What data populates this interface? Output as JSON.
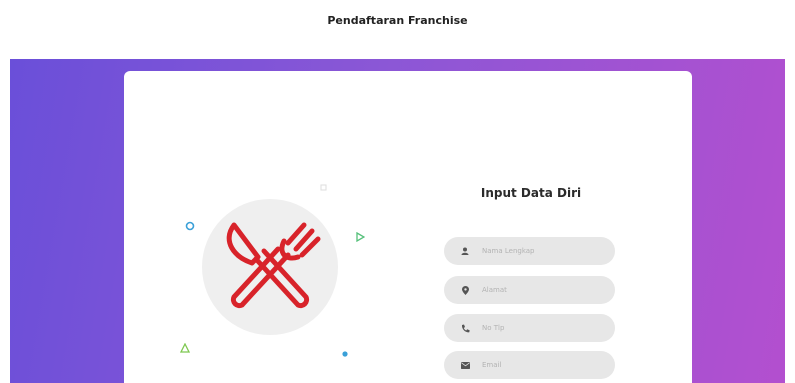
{
  "page": {
    "title": "Pendaftaran Franchise"
  },
  "form": {
    "title": "Input Data Diri",
    "fields": [
      {
        "icon": "user-icon",
        "placeholder": "Nama Lengkap"
      },
      {
        "icon": "map-marker-icon",
        "placeholder": "Alamat"
      },
      {
        "icon": "phone-icon",
        "placeholder": "No Tlp"
      },
      {
        "icon": "envelope-icon",
        "placeholder": "Email"
      }
    ]
  },
  "illustration": {
    "icon": "fork-knife-icon"
  },
  "colors": {
    "gradient_start": "#6a4fd9",
    "gradient_end": "#b34fcf",
    "accent_red": "#d8232a",
    "field_bg": "#e7e7e7"
  }
}
